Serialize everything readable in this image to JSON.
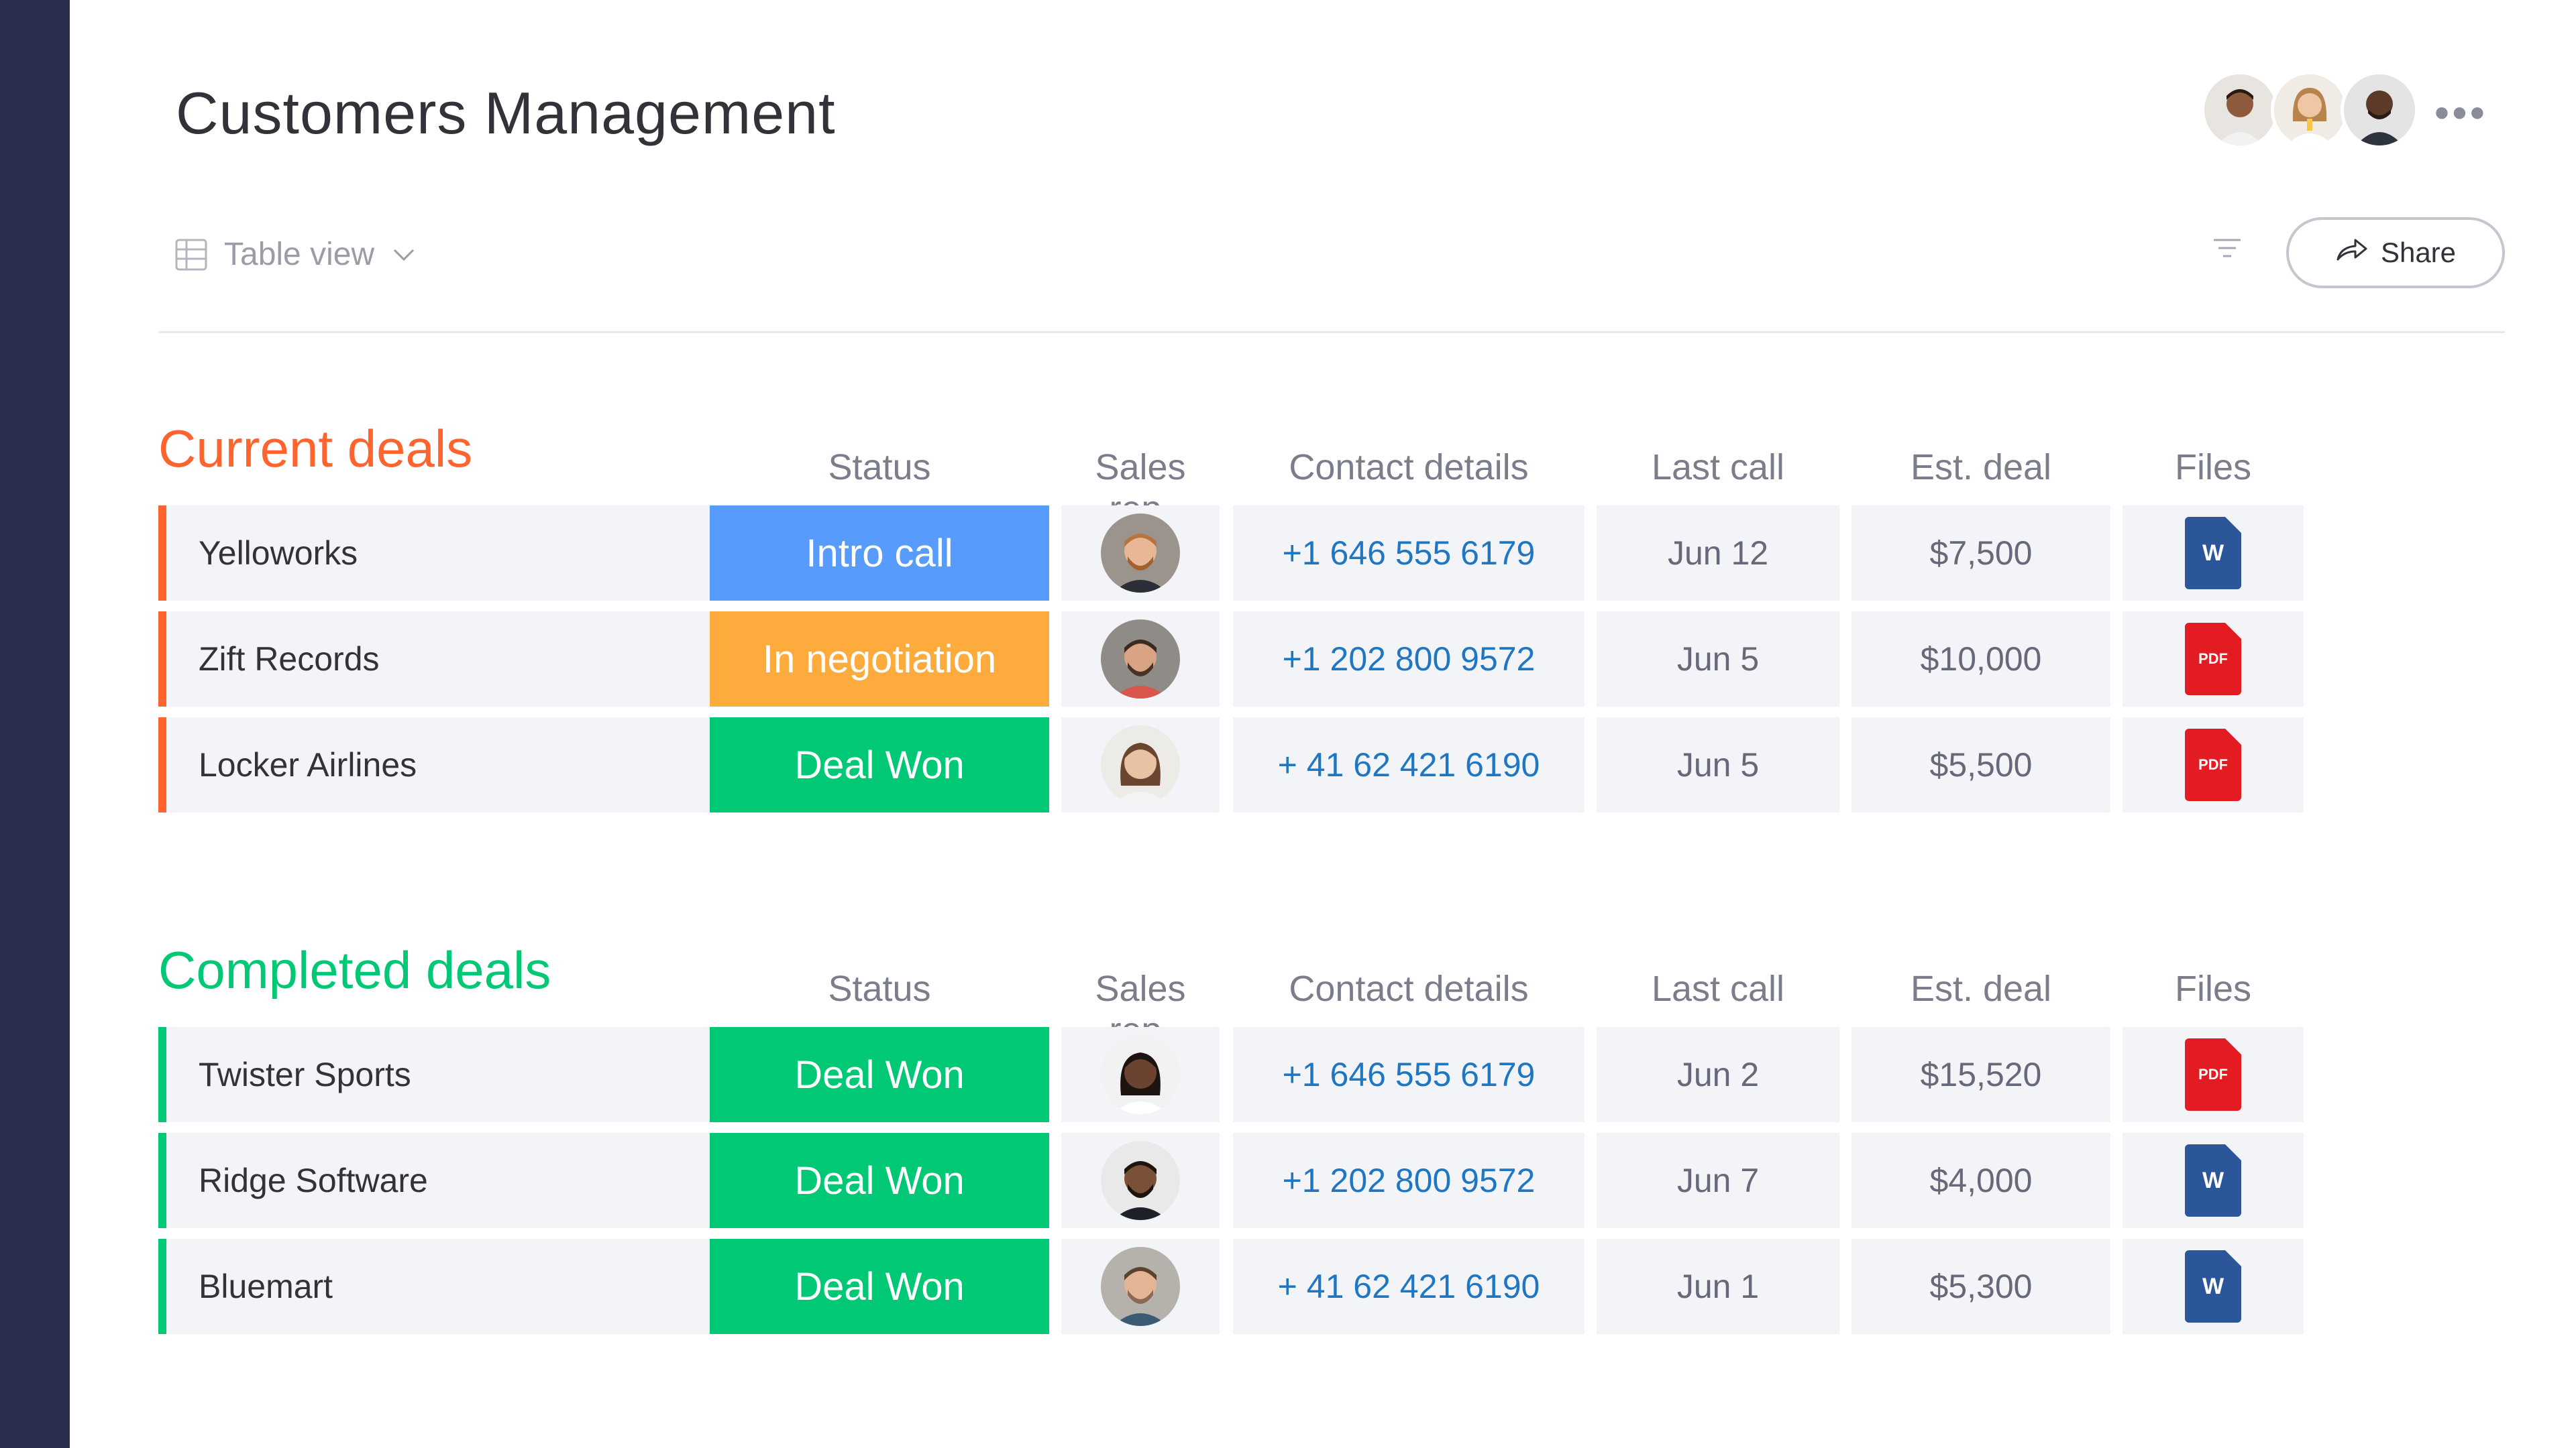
{
  "board": {
    "title": "Customers Management",
    "view_label": "Table view",
    "share_label": "Share",
    "more_label": "•••"
  },
  "colors": {
    "sidebar": "#292f4c",
    "current_group": "#ff642e",
    "completed_group": "#00c875",
    "intro_call": "#579bfc",
    "in_negotiation": "#fdab3d",
    "deal_won": "#00c875",
    "phone_link": "#1f76c2"
  },
  "columns": {
    "status": "Status",
    "sales_rep": "Sales rep.",
    "contact": "Contact details",
    "last_call": "Last call",
    "est_deal": "Est. deal",
    "files": "Files"
  },
  "groups": [
    {
      "title": "Current deals",
      "color": "#ff642e",
      "rows": [
        {
          "name": "Yelloworks",
          "updates": true,
          "status": "Intro call",
          "status_color": "#579bfc",
          "rep": "bearded-man",
          "phone": "+1 646 555 6179",
          "last_call": "Jun 12",
          "est_deal": "$7,500",
          "file_type": "word",
          "file_label": "W"
        },
        {
          "name": "Zift Records",
          "updates": false,
          "status": "In negotiation",
          "status_color": "#fdab3d",
          "rep": "smiling-man",
          "phone": "+1 202 800 9572",
          "last_call": "Jun 5",
          "est_deal": "$10,000",
          "file_type": "pdf",
          "file_label": "PDF"
        },
        {
          "name": "Locker Airlines",
          "updates": true,
          "status": "Deal Won",
          "status_color": "#00c875",
          "rep": "woman-curly",
          "phone": "+ 41 62 421 6190",
          "last_call": "Jun 5",
          "est_deal": "$5,500",
          "file_type": "pdf",
          "file_label": "PDF"
        }
      ]
    },
    {
      "title": "Completed deals",
      "color": "#00c875",
      "rows": [
        {
          "name": "Twister Sports",
          "updates": false,
          "status": "Deal Won",
          "status_color": "#00c875",
          "rep": "woman-glasses",
          "phone": "+1 646 555 6179",
          "last_call": "Jun 2",
          "est_deal": "$15,520",
          "file_type": "pdf",
          "file_label": "PDF"
        },
        {
          "name": "Ridge Software",
          "updates": false,
          "status": "Deal Won",
          "status_color": "#00c875",
          "rep": "man-beard-dark",
          "phone": "+1 202 800 9572",
          "last_call": "Jun 7",
          "est_deal": "$4,000",
          "file_type": "word",
          "file_label": "W"
        },
        {
          "name": "Bluemart",
          "updates": false,
          "status": "Deal Won",
          "status_color": "#00c875",
          "rep": "man-stubble",
          "phone": "+ 41 62 421 6190",
          "last_call": "Jun 1",
          "est_deal": "$5,300",
          "file_type": "word",
          "file_label": "W"
        }
      ]
    }
  ]
}
